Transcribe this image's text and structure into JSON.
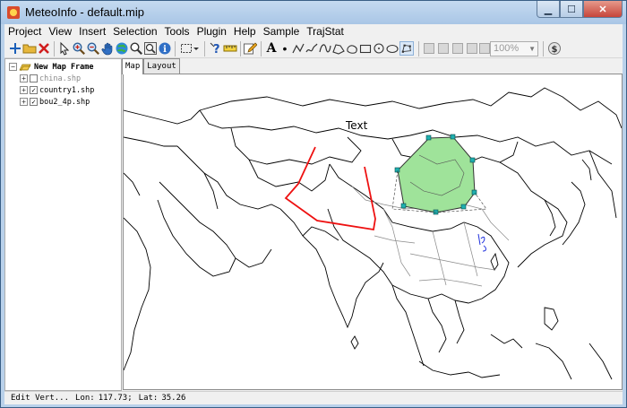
{
  "window": {
    "title": "MeteoInfo - default.mip",
    "controls": {
      "minimize": "▁",
      "maximize": "☐",
      "close": "✕"
    }
  },
  "menubar": {
    "items": [
      "Project",
      "View",
      "Insert",
      "Selection",
      "Tools",
      "Plugin",
      "Help",
      "Sample",
      "TrajStat"
    ]
  },
  "toolbar": {
    "zoom_value": "100%",
    "text_tool_label": "A",
    "point_tool_label": "•"
  },
  "layers": {
    "frame_label": "New Map Frame",
    "items": [
      {
        "label": "china.shp",
        "checked": false,
        "dim": true
      },
      {
        "label": "country1.shp",
        "checked": true,
        "dim": false
      },
      {
        "label": "bou2_4p.shp",
        "checked": true,
        "dim": false
      }
    ]
  },
  "tabs": {
    "map": "Map",
    "layout": "Layout"
  },
  "map": {
    "text_element": "Text",
    "polygon_fill": "#9fe39a",
    "polyline_color": "#ee1111",
    "vertex_color": "#1fb0b0",
    "symbol_color": "#2233dd"
  },
  "status": {
    "mode": "Edit Vert...",
    "lon_label": "Lon:",
    "lon_value": "117.73;",
    "lat_label": "Lat:",
    "lat_value": "35.26"
  }
}
